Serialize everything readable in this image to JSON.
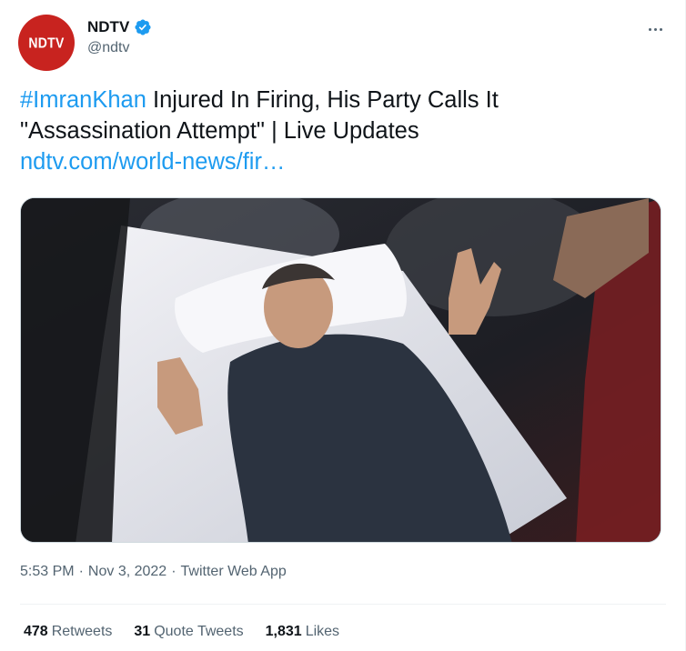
{
  "author": {
    "avatar_text": "NDTV",
    "display_name": "NDTV",
    "handle": "@ndtv",
    "verified_icon": "verified-badge-icon"
  },
  "tweet": {
    "hashtag": "#ImranKhan",
    "text_line1_rest": " Injured In Firing, His Party Calls It",
    "text_line2": "\"Assassination Attempt\" | Live Updates",
    "link": "ndtv.com/world-news/fir…"
  },
  "media": {
    "type": "photo"
  },
  "meta": {
    "time": "5:53 PM",
    "date": "Nov 3, 2022",
    "source": "Twitter Web App",
    "separator": "·"
  },
  "stats": {
    "retweets_count": "478",
    "retweets_label": "Retweets",
    "quote_count": "31",
    "quote_label": "Quote Tweets",
    "likes_count": "1,831",
    "likes_label": "Likes"
  },
  "colors": {
    "brand_red": "#c8231f",
    "link_blue": "#1d9bf0",
    "secondary_text": "#536471"
  }
}
